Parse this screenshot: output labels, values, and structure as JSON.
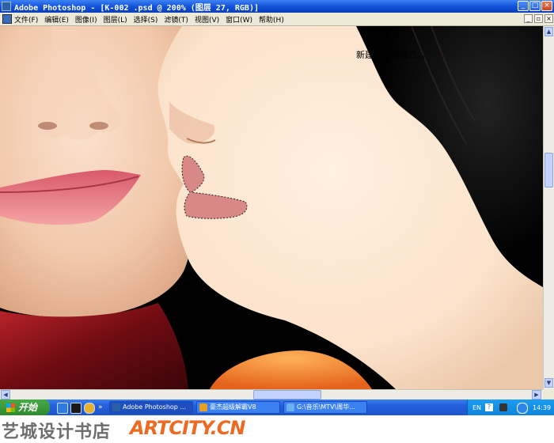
{
  "window": {
    "title": "Adobe Photoshop - [K-002 .psd @ 200% (图层 27, RGB)]",
    "min_glyph": "_",
    "max_glyph": "□",
    "close_glyph": "×"
  },
  "menubar": {
    "items": [
      "文件(F)",
      "编辑(E)",
      "图像(I)",
      "图层(L)",
      "选择(S)",
      "滤镜(T)",
      "视图(V)",
      "窗口(W)",
      "帮助(H)"
    ],
    "mdi_min": "_",
    "mdi_restore": "▫",
    "mdi_close": "×"
  },
  "canvas": {
    "annotation": "新建一层画嘴巴。。",
    "selection_fill": "#d98888"
  },
  "scrollbars": {
    "up": "▲",
    "down": "▼",
    "left": "◀",
    "right": "▶"
  },
  "taskbar": {
    "start_label": "开始",
    "tasks": [
      {
        "label": "Adobe Photoshop ..."
      },
      {
        "label": "豪杰超级解霸V8"
      },
      {
        "label": "G:\\音乐\\MTV\\周华..."
      }
    ],
    "tray": {
      "lang": "EN",
      "help": "?",
      "time": "14:39"
    }
  },
  "watermark": {
    "cn": "艺城设计书店",
    "en": "ARTCITY.CN"
  }
}
